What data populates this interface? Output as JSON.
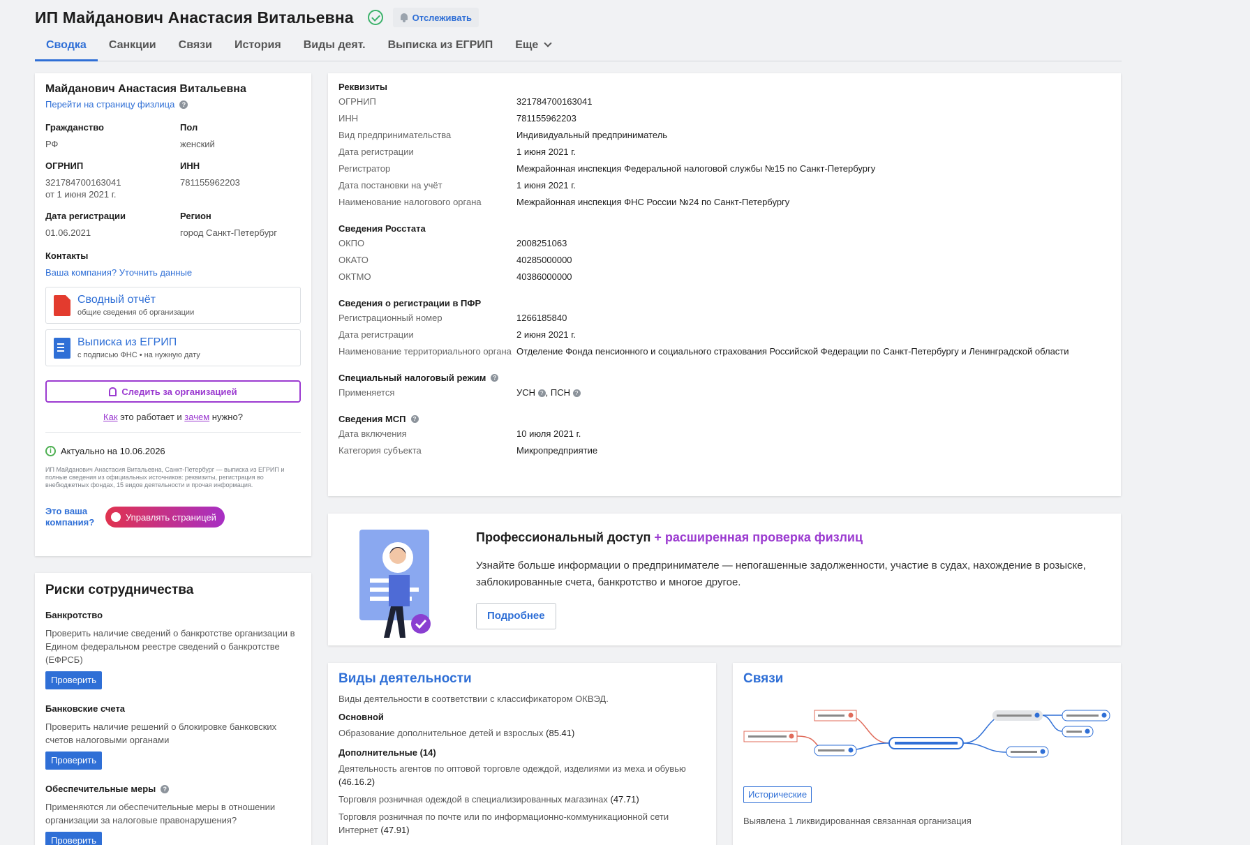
{
  "header": {
    "title": "ИП Майданович Анастасия Витальевна",
    "track_label": "Отслеживать",
    "tabs": [
      "Сводка",
      "Санкции",
      "Связи",
      "История",
      "Виды деят.",
      "Выписка из ЕГРИП",
      "Еще"
    ]
  },
  "summary": {
    "name": "Майданович Анастасия Витальевна",
    "person_link": "Перейти на страницу физлица",
    "citizenship_label": "Гражданство",
    "citizenship": "РФ",
    "gender_label": "Пол",
    "gender": "женский",
    "ogrnip_label": "ОГРНИП",
    "ogrnip": "321784700163041",
    "ogrnip_date": "от 1 июня 2021 г.",
    "inn_label": "ИНН",
    "inn": "781155962203",
    "reg_date_label": "Дата регистрации",
    "reg_date": "01.06.2021",
    "region_label": "Регион",
    "region": "город Санкт-Петербург",
    "contacts_label": "Контакты",
    "contacts_link": "Ваша компания? Уточнить данные",
    "report_title": "Сводный отчёт",
    "report_sub": "общие сведения об организации",
    "extract_title": "Выписка из ЕГРИП",
    "extract_sub": "с подписью ФНС • на нужную дату",
    "follow_label": "Следить за организацией",
    "how_1": "Как",
    "how_2": " это работает и ",
    "how_3": "зачем",
    "how_4": " нужно?",
    "actual": "Актуально на 10.06.2026",
    "description": "ИП Майданович Анастасия Витальевна, Санкт-Петербург — выписка из ЕГРИП и полные сведения из официальных источников: реквизиты, регистрация во внебюджетных фондах, 15 видов деятельности и прочая информация.",
    "manage_q": "Это ваша компания?",
    "manage_label": "Управлять страницей"
  },
  "risks": {
    "title": "Риски сотрудничества",
    "items": [
      {
        "head": "Банкротство",
        "text": "Проверить наличие сведений о банкротстве организации в Едином федеральном реестре сведений о банкротстве (ЕФРСБ)",
        "btn": "Проверить"
      },
      {
        "head": "Банковские счета",
        "text": "Проверить наличие решений о блокировке банковских счетов налоговыми органами",
        "btn": "Проверить"
      },
      {
        "head": "Обеспечительные меры",
        "text": "Применяются ли обеспечительные меры в отношении организации за налоговые правонарушения?",
        "btn": "Проверить"
      }
    ]
  },
  "requisites": {
    "title": "Реквизиты",
    "rows": [
      [
        "ОГРНИП",
        "321784700163041"
      ],
      [
        "ИНН",
        "781155962203"
      ],
      [
        "Вид предпринимательства",
        "Индивидуальный предприниматель"
      ],
      [
        "Дата регистрации",
        "1 июня 2021 г."
      ],
      [
        "Регистратор",
        "Межрайонная инспекция Федеральной налоговой службы №15 по Санкт-Петербургу"
      ],
      [
        "Дата постановки на учёт",
        "1 июня 2021 г."
      ],
      [
        "Наименование налогового органа",
        "Межрайонная инспекция ФНС России №24 по Санкт-Петербургу"
      ]
    ],
    "rosstat_title": "Сведения Росстата",
    "rosstat": [
      [
        "ОКПО",
        "2008251063"
      ],
      [
        "ОКАТО",
        "40285000000"
      ],
      [
        "ОКТМО",
        "40386000000"
      ]
    ],
    "pfr_title": "Сведения о регистрации в ПФР",
    "pfr": [
      [
        "Регистрационный номер",
        "1266185840"
      ],
      [
        "Дата регистрации",
        "2 июня 2021 г."
      ],
      [
        "Наименование территориального органа",
        "Отделение Фонда пенсионного и социального страхования Российской Федерации по Санкт-Петербургу и Ленинградской области"
      ]
    ],
    "tax_title": "Специальный налоговый режим",
    "tax_key": "Применяется",
    "tax_usn": "УСН",
    "tax_psn": "ПСН",
    "msp_title": "Сведения МСП",
    "msp": [
      [
        "Дата включения",
        "10 июля 2021 г."
      ],
      [
        "Категория субъекта",
        "Микропредприятие"
      ]
    ]
  },
  "promo": {
    "title_1": "Профессиональный доступ",
    "title_2": " + расширенная проверка физлиц",
    "text": "Узнайте больше информации о предпринимателе — непогашенные задолженности, участие в судах, нахождение в розыске, заблокированные счета, банкротство и многое другое.",
    "btn": "Подробнее"
  },
  "activities": {
    "title": "Виды деятельности",
    "desc": "Виды деятельности в соответствии с классификатором ОКВЭД.",
    "main_label": "Основной",
    "main": {
      "text": "Образование дополнительное детей и взрослых",
      "code": "(85.41)"
    },
    "extra_label": "Дополнительные (14)",
    "extra": [
      {
        "text": "Деятельность агентов по оптовой торговле одеждой, изделиями из меха и обувью",
        "code": "(46.16.2)"
      },
      {
        "text": "Торговля розничная одеждой в специализированных магазинах",
        "code": "(47.71)"
      },
      {
        "text": "Торговля розничная по почте или по информационно-коммуникационной сети Интернет",
        "code": "(47.91)"
      }
    ]
  },
  "links": {
    "title": "Связи",
    "hist_btn": "Исторические",
    "note": "Выявлена 1 ликвидированная связанная организация"
  }
}
